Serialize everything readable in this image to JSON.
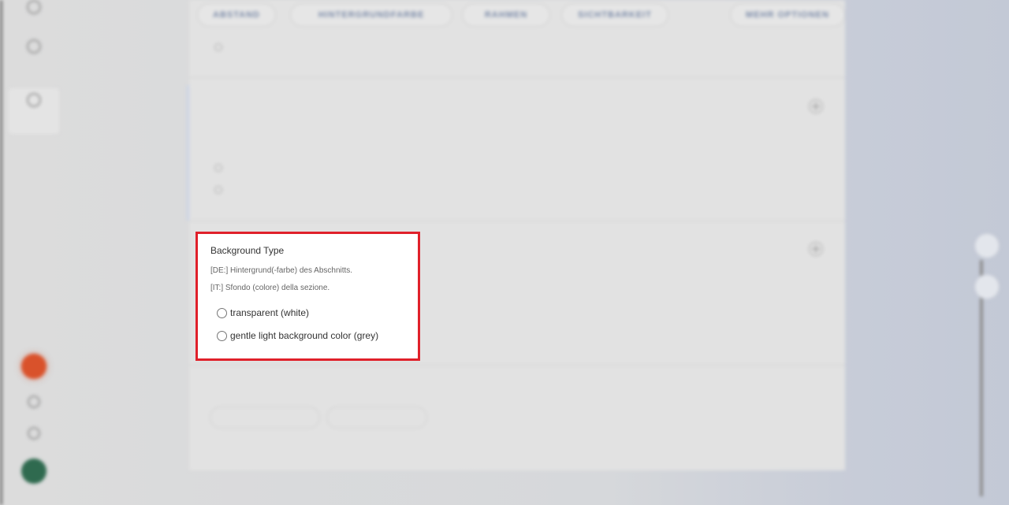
{
  "toolbar": {
    "pills": [
      "ABSTAND",
      "HINTERGRUNDFARBE",
      "RAHMEN",
      "SICHTBARKEIT",
      "MEHR OPTIONEN"
    ]
  },
  "background_type": {
    "title": "Background Type",
    "desc_de": "[DE:] Hintergrund(-farbe) des Abschnitts.",
    "desc_it": "[IT:] Sfondo (colore) della sezione.",
    "options": [
      "transparent (white)",
      "gentle light background color (grey)"
    ]
  },
  "colors": {
    "highlight": "#e0202a",
    "fab_orange": "#d9522b",
    "fab_green": "#2f6a4f"
  }
}
